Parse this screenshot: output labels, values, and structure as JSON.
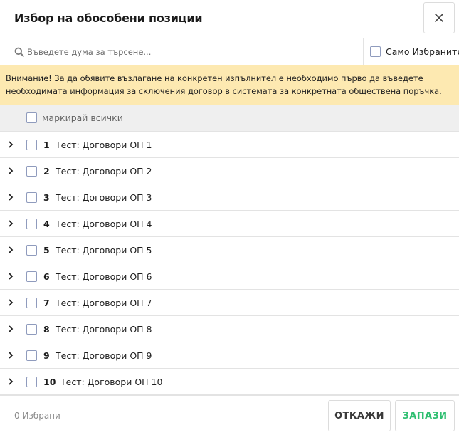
{
  "dialog": {
    "title": "Избор на обособени позиции",
    "close_icon": "close-icon"
  },
  "search": {
    "placeholder": "Въведете дума за търсене...",
    "value": "",
    "icon": "search-icon",
    "only_selected_label": "Само Избраните",
    "only_selected_checked": false
  },
  "warning": {
    "text": "Внимание! За да обявите възлагане на конкретен изпълнител е необходимо първо да въведете необходимата информация за сключения договор в системата за конкретната обществена поръчка.",
    "background": "#fde9b1"
  },
  "select_all": {
    "label": "маркирай всички",
    "checked": false
  },
  "items": [
    {
      "number": "1",
      "name": "Тест: Договори ОП 1",
      "checked": false
    },
    {
      "number": "2",
      "name": "Тест: Договори ОП 2",
      "checked": false
    },
    {
      "number": "3",
      "name": "Тест: Договори ОП 3",
      "checked": false
    },
    {
      "number": "4",
      "name": "Тест: Договори ОП 4",
      "checked": false
    },
    {
      "number": "5",
      "name": "Тест: Договори ОП 5",
      "checked": false
    },
    {
      "number": "6",
      "name": "Тест: Договори ОП 6",
      "checked": false
    },
    {
      "number": "7",
      "name": "Тест: Договори ОП 7",
      "checked": false
    },
    {
      "number": "8",
      "name": "Тест: Договори ОП 8",
      "checked": false
    },
    {
      "number": "9",
      "name": "Тест: Договори ОП 9",
      "checked": false
    },
    {
      "number": "10",
      "name": "Тест: Договори ОП 10",
      "checked": false
    }
  ],
  "footer": {
    "selected_count": "0 Избрани",
    "cancel_label": "ОТКАЖИ",
    "save_label": "ЗАПАЗИ",
    "save_color": "#2fbf71"
  },
  "colors": {
    "checkbox_border": "#8f9bbd",
    "divider": "#e3e3e3",
    "select_all_bg": "#efefef"
  }
}
